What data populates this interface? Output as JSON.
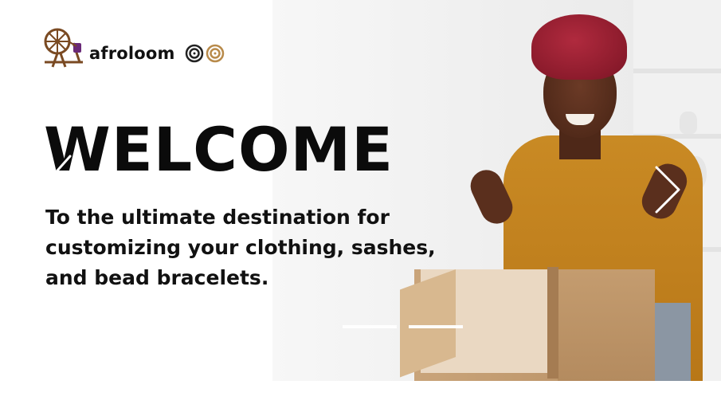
{
  "brand": {
    "name": "afroloom",
    "logo_icon": "spinning-wheel-icon",
    "badge_icon": "concentric-rings-icon",
    "colors": {
      "wheel_wood": "#7a4a22",
      "wheel_accent": "#6a2a78",
      "ring_dark": "#222222",
      "ring_gold": "#b88a4a"
    }
  },
  "hero": {
    "headline": "WELCOME",
    "tagline_lines": [
      "To the ultimate destination for",
      "customizing your clothing, sashes,",
      "and bead bracelets."
    ]
  },
  "carousel": {
    "prev_icon": "chevron-left-icon",
    "next_icon": "chevron-right-icon",
    "indicators": [
      {
        "active": false
      },
      {
        "active": true
      }
    ]
  }
}
